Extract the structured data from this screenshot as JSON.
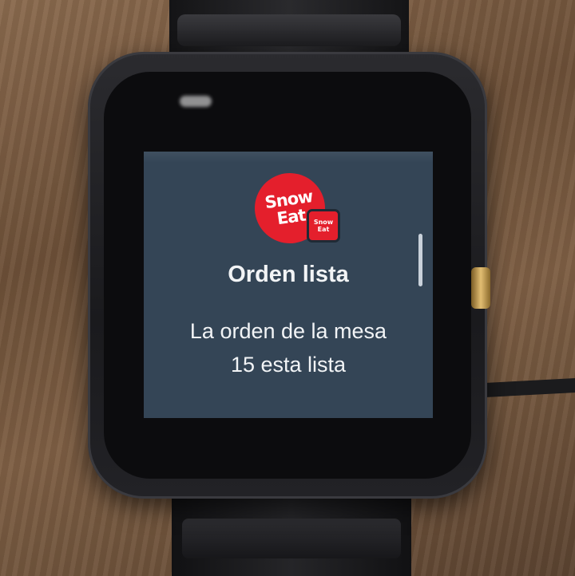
{
  "app": {
    "icon_text_line1": "Snow",
    "icon_text_line2": "Eat",
    "badge_line1": "Snow",
    "badge_line2": "Eat",
    "brand_color": "#e41f2c"
  },
  "notification": {
    "title": "Orden lista",
    "message_line1": "La orden de la mesa",
    "message_line2": "15 esta lista"
  },
  "colors": {
    "screen_background": "#344556",
    "text": "#f2f4f6"
  },
  "icons": [
    "app-icon",
    "badge-icon",
    "scroll-indicator"
  ]
}
